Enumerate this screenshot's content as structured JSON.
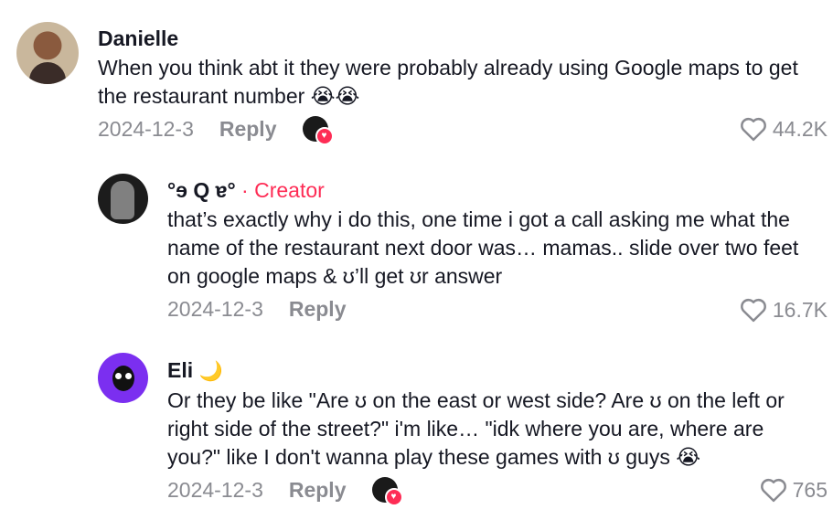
{
  "comments": [
    {
      "author": "Danielle",
      "text": "When you think abt it they were probably already using Google maps to get the restaurant number 😭😭",
      "date": "2024-12-3",
      "reply_label": "Reply",
      "likes": "44.2K"
    },
    {
      "author": "°ɘ Q ɐ°",
      "creator_tag": "· Creator",
      "text": "that’s exactly why i do this, one time i got a call asking me what the name of the restaurant next door was… mamas.. slide over two feet on google maps & ʊ’ll get ʊr answer",
      "date": "2024-12-3",
      "reply_label": "Reply",
      "likes": "16.7K"
    },
    {
      "author": "Eli",
      "author_emoji": "🌙",
      "text": "Or they be like \"Are ʊ on the east or west side? Are ʊ on the left or right side of the street?\" i'm like… \"idk where you are, where are you?\" like I don't wanna play these games with ʊ guys 😭",
      "date": "2024-12-3",
      "reply_label": "Reply",
      "likes": "765"
    }
  ],
  "colors": {
    "accent": "#fe2c55",
    "muted": "#8a8b91",
    "text": "#161823"
  }
}
